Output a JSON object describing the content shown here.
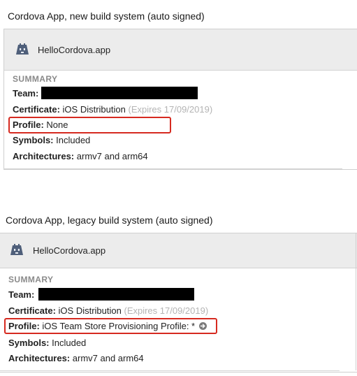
{
  "panels": [
    {
      "caption": "Cordova App, new build system (auto signed)",
      "app_name": "HelloCordova.app",
      "summary_heading": "SUMMARY",
      "team": {
        "label": "Team:",
        "value": ""
      },
      "certificate": {
        "label": "Certificate:",
        "value": "iOS Distribution",
        "expires": "(Expires 17/09/2019)"
      },
      "profile": {
        "label": "Profile:",
        "value": "None"
      },
      "symbols": {
        "label": "Symbols:",
        "value": "Included"
      },
      "architectures": {
        "label": "Architectures:",
        "value": "armv7 and arm64"
      }
    },
    {
      "caption": "Cordova App, legacy build system (auto signed)",
      "app_name": "HelloCordova.app",
      "summary_heading": "SUMMARY",
      "team": {
        "label": "Team:",
        "value": ""
      },
      "certificate": {
        "label": "Certificate:",
        "value": "iOS Distribution",
        "expires": "(Expires 17/09/2019)"
      },
      "profile": {
        "label": "Profile:",
        "value": "iOS Team Store Provisioning Profile: *"
      },
      "symbols": {
        "label": "Symbols:",
        "value": "Included"
      },
      "architectures": {
        "label": "Architectures:",
        "value": "armv7 and arm64"
      }
    }
  ],
  "colors": {
    "highlight_border": "#d62a20",
    "header_background": "#ececec",
    "muted_text": "#b4b4b4",
    "redaction": "#000000"
  },
  "icons": {
    "app": "cordova-app-icon",
    "profile_link": "arrow-circle-right-icon"
  }
}
